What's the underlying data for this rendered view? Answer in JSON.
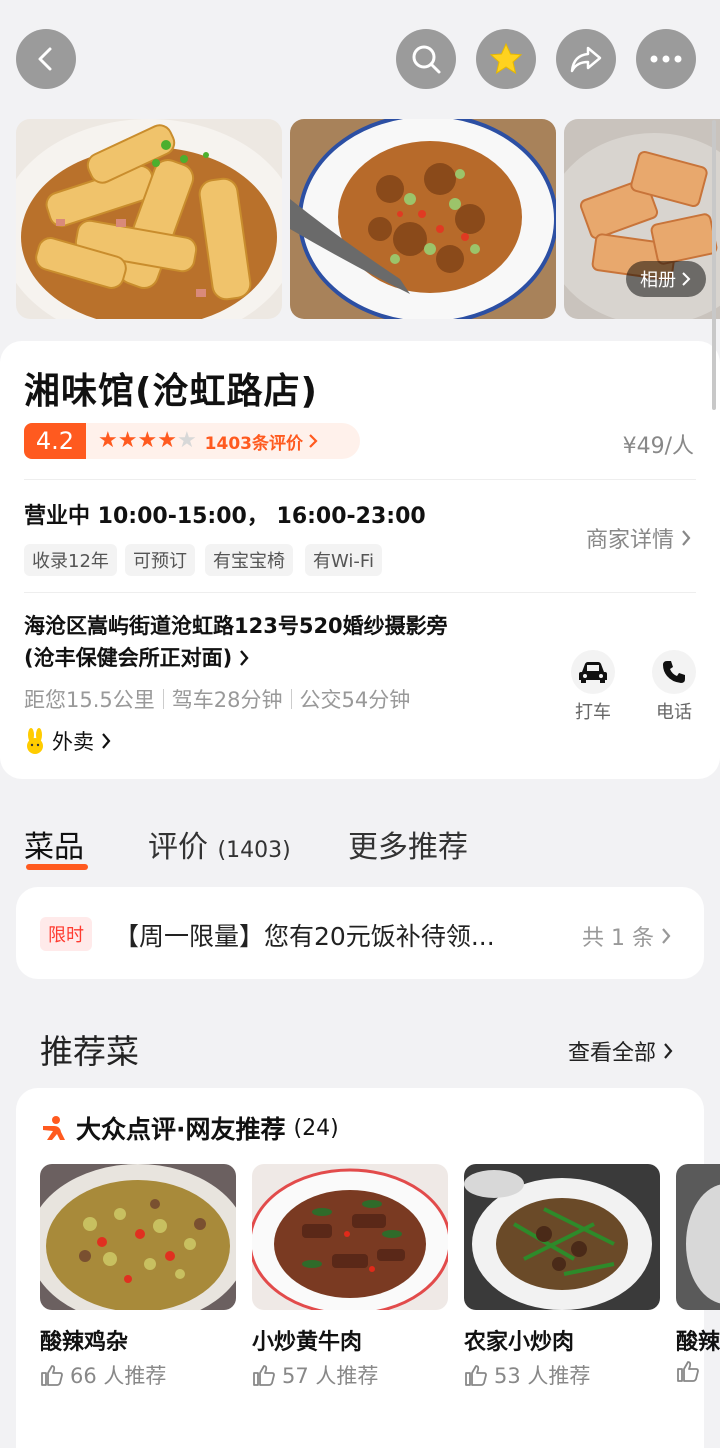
{
  "top_bar": {
    "back_icon": "back-arrow-icon",
    "search_icon": "search-icon",
    "favorite_icon": "star-icon",
    "share_icon": "share-icon",
    "more_icon": "more-icon"
  },
  "photos": {
    "album_label": "相册"
  },
  "shop": {
    "name": "湘味馆(沧虹路店)",
    "rating": "4.2",
    "stars": 4,
    "review_count": "1403条评价",
    "price": "¥49/人",
    "status": "营业中 10:00-15:00， 16:00-23:00",
    "tags": [
      "收录12年",
      "可预订",
      "有宝宝椅",
      "有Wi-Fi"
    ],
    "merchant_detail": "商家详情",
    "address_line1": "海沧区嵩屿街道沧虹路123号520婚纱摄影旁",
    "address_line2": "(沧丰保健会所正对面)",
    "distance": "距您15.5公里",
    "drive": "驾车28分钟",
    "transit": "公交54分钟",
    "taxi_label": "打车",
    "phone_label": "电话",
    "takeout_label": "外卖"
  },
  "tabs": [
    {
      "label": "菜品",
      "count": ""
    },
    {
      "label": "评价",
      "count": "(1403)"
    },
    {
      "label": "更多推荐",
      "count": ""
    }
  ],
  "promo": {
    "badge": "限时",
    "text": "【周一限量】您有20元饭补待领...",
    "count": "共 1 条"
  },
  "recommended": {
    "title": "推荐菜",
    "view_all": "查看全部",
    "card_title": "大众点评·网友推荐",
    "card_count": "(24)",
    "dishes": [
      {
        "name": "酸辣鸡杂",
        "likes": "66 人推荐"
      },
      {
        "name": "小炒黄牛肉",
        "likes": "57 人推荐"
      },
      {
        "name": "农家小炒肉",
        "likes": "53 人推荐"
      },
      {
        "name": "酸辣",
        "likes": ""
      }
    ]
  },
  "colors": {
    "accent": "#ff5a1f",
    "background": "#f2f2f4"
  }
}
